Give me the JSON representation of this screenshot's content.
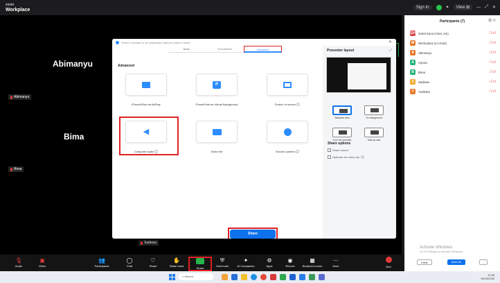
{
  "app": {
    "brand_line1": "zoom",
    "brand_line2": "Workplace"
  },
  "topbar": {
    "signin": "Sign In",
    "view": "View ⊞"
  },
  "stage": {
    "big_names": [
      "Abimanyu",
      "Bima"
    ],
    "small_names": [
      "Abimanyu",
      "Bima",
      "Sadewa"
    ]
  },
  "dialog": {
    "title": "Select a window or an application that you want to share",
    "tabs": [
      "Basic",
      "Documents",
      "Advanced"
    ],
    "section": "Advanced",
    "cards": [
      {
        "label": "iPhone/iPad via AirPlay",
        "icon": "airplay-icon"
      },
      {
        "label": "PowerPoint as Virtual Background",
        "icon": "powerpoint-icon"
      },
      {
        "label": "Portion of screen",
        "icon": "screen-portion-icon"
      },
      {
        "label": "Computer audio",
        "icon": "speaker-icon"
      },
      {
        "label": "Video file",
        "icon": "video-file-icon"
      },
      {
        "label": "Second camera",
        "icon": "camera-icon"
      }
    ],
    "share_label": "Share",
    "presenter_layout": "Presenter layout",
    "layouts": [
      "Standard view",
      "On background",
      "Side-by-side",
      "Over the shoulder"
    ],
    "share_options_title": "Share options",
    "share_sound": "Share sound",
    "optimize": "Optimize for video clip"
  },
  "participants": {
    "title": "Participants (7)",
    "list": [
      {
        "initial": "GH",
        "name": "Gatot Kaca (Host, me)",
        "color": "#d9434b"
      },
      {
        "initial": "W",
        "name": "Werkudara (Co-host)",
        "color": "#e6792b"
      },
      {
        "initial": "A",
        "name": "Abimanyu",
        "color": "#e6792b"
      },
      {
        "initial": "A",
        "name": "Arjuna",
        "color": "#27b37a"
      },
      {
        "initial": "B",
        "name": "Bima",
        "color": "#27b37a"
      },
      {
        "initial": "S",
        "name": "Sadewa",
        "color": "#f0a92b"
      },
      {
        "initial": "Y",
        "name": "Yudistira",
        "color": "#e6792b"
      }
    ],
    "activate_title": "Activate Windows",
    "activate_sub": "Go to Settings to activate Windows.",
    "invite": "Invite",
    "mute_all": "Mute All",
    "more": "..."
  },
  "toolbar": {
    "items": [
      "Audio",
      "Video",
      "Participants",
      "Chat",
      "React",
      "Raise hand",
      "Share",
      "Host tools",
      "AI Companion",
      "Apps",
      "Record",
      "Breakout rooms",
      "More",
      "End"
    ],
    "participants_count": "7"
  },
  "taskbar": {
    "search": "Search",
    "time": "11:38",
    "date": "10/04/2025"
  }
}
